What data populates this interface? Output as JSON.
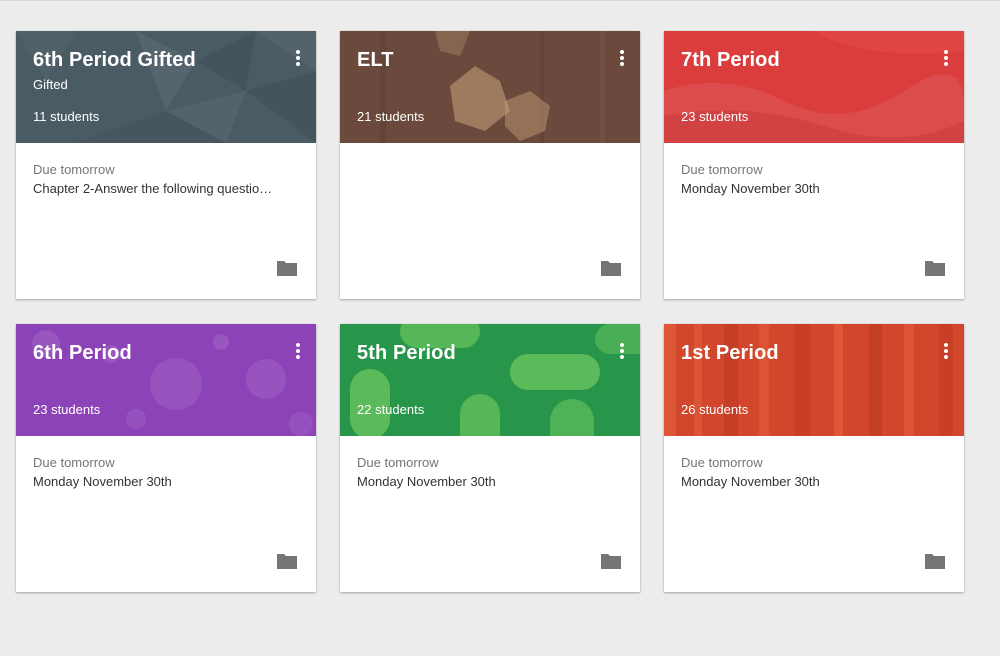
{
  "colors": {
    "page_background": "#ececec",
    "card_background": "#ffffff",
    "muted_text": "#757575",
    "body_text": "#333333",
    "folder_icon": "#757575"
  },
  "classes": [
    {
      "title": "6th Period Gifted",
      "section": "Gifted",
      "students": "11 students",
      "due_label": "Due tomorrow",
      "due_item": "Chapter 2-Answer the following questio…",
      "theme": "slate-geometric",
      "color": "#4b5b64",
      "menu_icon": "more-vert-icon",
      "folder_icon": "folder-icon"
    },
    {
      "title": "ELT",
      "section": "",
      "students": "21 students",
      "due_label": "",
      "due_item": "",
      "theme": "brown-leaves",
      "color": "#6b4a3d",
      "menu_icon": "more-vert-icon",
      "folder_icon": "folder-icon"
    },
    {
      "title": "7th Period",
      "section": "",
      "students": "23 students",
      "due_label": "Due tomorrow",
      "due_item": "Monday November 30th",
      "theme": "red-paint",
      "color": "#db3d3d",
      "menu_icon": "more-vert-icon",
      "folder_icon": "folder-icon"
    },
    {
      "title": "6th Period",
      "section": "",
      "students": "23 students",
      "due_label": "Due tomorrow",
      "due_item": "Monday November 30th",
      "theme": "purple-bubbles",
      "color": "#8d43b8",
      "menu_icon": "more-vert-icon",
      "folder_icon": "folder-icon"
    },
    {
      "title": "5th Period",
      "section": "",
      "students": "22 students",
      "due_label": "Due tomorrow",
      "due_item": "Monday November 30th",
      "theme": "green-capsules",
      "color": "#27964a",
      "menu_icon": "more-vert-icon",
      "folder_icon": "folder-icon"
    },
    {
      "title": "1st Period",
      "section": "",
      "students": "26 students",
      "due_label": "Due tomorrow",
      "due_item": "Monday November 30th",
      "theme": "orange-stripes",
      "color": "#d2462b",
      "menu_icon": "more-vert-icon",
      "folder_icon": "folder-icon"
    }
  ]
}
